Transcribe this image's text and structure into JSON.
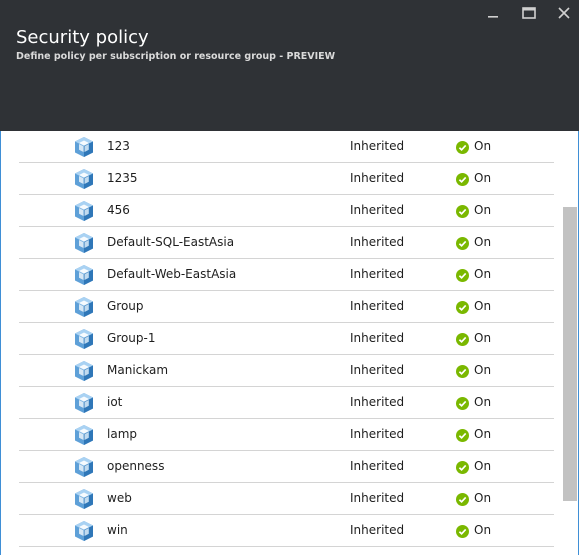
{
  "header": {
    "title": "Security policy",
    "subtitle": "Define policy per subscription or resource group - PREVIEW",
    "background": "#2f3236"
  },
  "window_controls": [
    "minimize-icon",
    "maximize-icon",
    "close-icon"
  ],
  "accent_color": "#3f8fd6",
  "status_color": "#7ab800",
  "rows": [
    {
      "name": "123",
      "inheritance": "Inherited",
      "state": "On"
    },
    {
      "name": "1235",
      "inheritance": "Inherited",
      "state": "On"
    },
    {
      "name": "456",
      "inheritance": "Inherited",
      "state": "On"
    },
    {
      "name": "Default-SQL-EastAsia",
      "inheritance": "Inherited",
      "state": "On"
    },
    {
      "name": "Default-Web-EastAsia",
      "inheritance": "Inherited",
      "state": "On"
    },
    {
      "name": "Group",
      "inheritance": "Inherited",
      "state": "On"
    },
    {
      "name": "Group-1",
      "inheritance": "Inherited",
      "state": "On"
    },
    {
      "name": "Manickam",
      "inheritance": "Inherited",
      "state": "On"
    },
    {
      "name": "iot",
      "inheritance": "Inherited",
      "state": "On"
    },
    {
      "name": "lamp",
      "inheritance": "Inherited",
      "state": "On"
    },
    {
      "name": "openness",
      "inheritance": "Inherited",
      "state": "On"
    },
    {
      "name": "web",
      "inheritance": "Inherited",
      "state": "On"
    },
    {
      "name": "win",
      "inheritance": "Inherited",
      "state": "On"
    }
  ]
}
